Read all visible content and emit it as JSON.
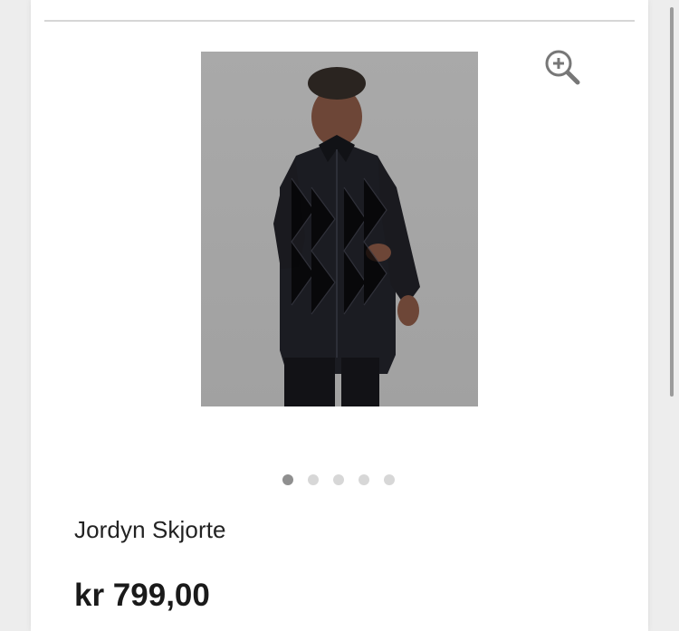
{
  "product": {
    "name": "Jordyn Skjorte",
    "price": "kr 799,00",
    "image": {
      "alt": "Jordyn Skjorte"
    }
  },
  "gallery": {
    "dots": [
      {
        "active": true
      },
      {
        "active": false
      },
      {
        "active": false
      },
      {
        "active": false
      },
      {
        "active": false
      }
    ]
  },
  "icons": {
    "zoom": "zoom-in-icon"
  },
  "colors": {
    "background": "#ededed",
    "card": "#ffffff",
    "text": "#222222",
    "dot_active": "#8f8f8f",
    "dot_inactive": "#d7d7d7"
  }
}
